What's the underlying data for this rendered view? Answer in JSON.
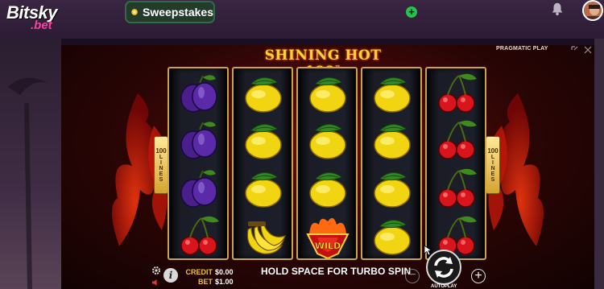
{
  "header": {
    "logo_top": "Bitsky",
    "logo_bottom": ".bet",
    "sweepstakes_label": "Sweepstakes",
    "add_label": "+"
  },
  "game": {
    "title": "SHINING HOT 100",
    "title_tm": "™",
    "provider": "PRAGMATIC PLAY",
    "lines_left": [
      "100",
      "LINES"
    ],
    "lines_right": [
      "100",
      "LINES"
    ],
    "reels": [
      [
        "plum",
        "plum",
        "plum",
        "cherry"
      ],
      [
        "lemon",
        "lemon",
        "lemon",
        "banana"
      ],
      [
        "lemon",
        "lemon",
        "lemon",
        "wild"
      ],
      [
        "lemon",
        "lemon",
        "lemon",
        "lemon"
      ],
      [
        "cherry",
        "cherry",
        "cherry",
        "cherry"
      ]
    ],
    "wild_text": "WILD"
  },
  "controls": {
    "credit_label": "CREDIT",
    "credit_value": "$0.00",
    "bet_label": "BET",
    "bet_value": "$1.00",
    "message": "HOLD SPACE FOR TURBO SPIN",
    "minus": "−",
    "plus": "+",
    "autoplay": "AUTOPLAY",
    "info": "i"
  },
  "colors": {
    "accent_gold": "#ffd23a",
    "reel_border": "#c9a44a",
    "sweeps_green": "#27c24c",
    "brand_pink": "#ff3fa0"
  }
}
